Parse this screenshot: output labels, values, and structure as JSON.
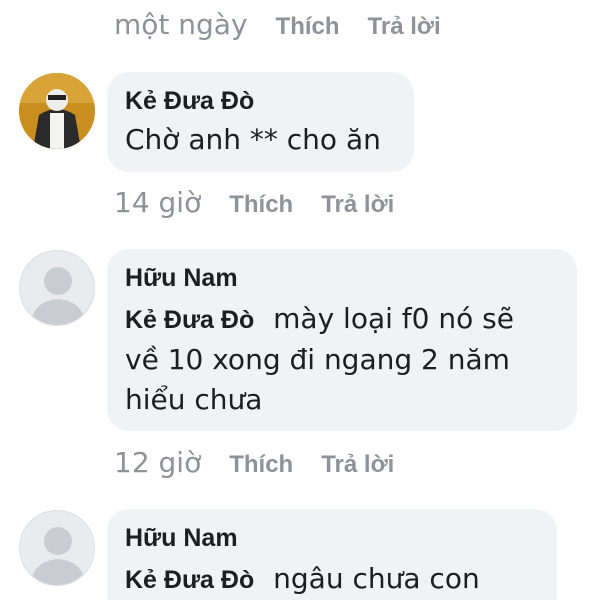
{
  "top_meta": {
    "time": "một ngày",
    "like": "Thích",
    "reply": "Trả lời"
  },
  "comments": [
    {
      "author": "Kẻ Đưa Đò",
      "text": "Chờ anh ** cho ăn",
      "time": "14 giờ",
      "like": "Thích",
      "reply": "Trả lời"
    },
    {
      "author": "Hữu Nam",
      "mention": "Kẻ Đưa Đò",
      "text_line1": "mày loại f0 nó sẽ",
      "text_line2": "về 10 xong đi ngang 2 năm",
      "text_line3": "hiểu chưa",
      "time": "12 giờ",
      "like": "Thích",
      "reply": "Trả lời"
    },
    {
      "author": "Hữu Nam",
      "mention": "Kẻ Đưa Đò",
      "text_line1": "ngâu chưa con"
    }
  ],
  "colors": {
    "bubble": "#f0f2f5",
    "meta": "#8e9299",
    "text": "#1c1e21"
  }
}
